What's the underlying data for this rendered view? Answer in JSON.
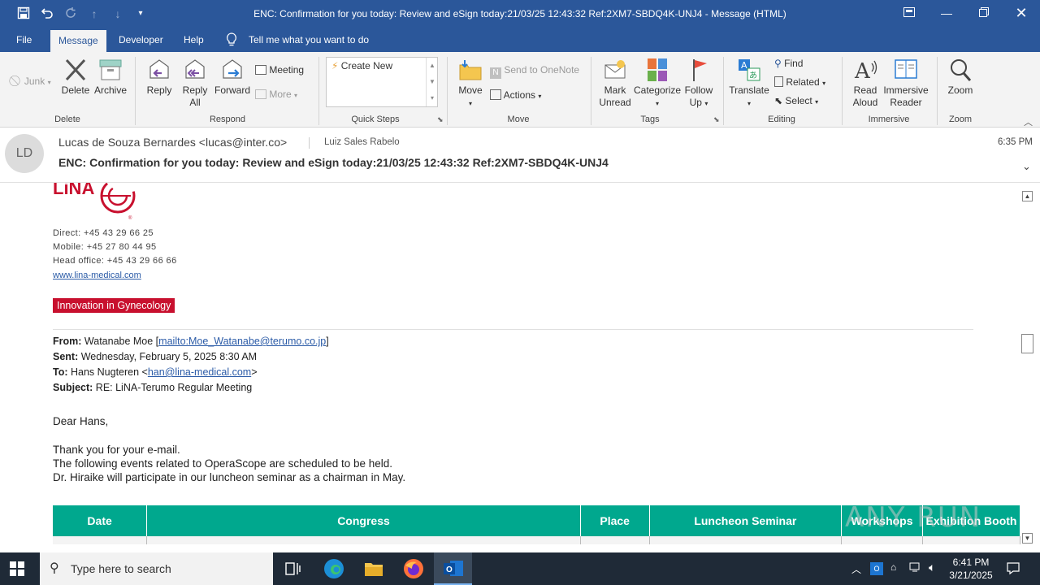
{
  "window": {
    "title": "ENC: Confirmation for you today: Review and eSign today:21/03/25 12:43:32 Ref:2XM7-SBDQ4K-UNJ4  -  Message (HTML)"
  },
  "tabs": [
    {
      "label": "File"
    },
    {
      "label": "Message"
    },
    {
      "label": "Developer"
    },
    {
      "label": "Help"
    }
  ],
  "tell_me": "Tell me what you want to do",
  "ribbon": {
    "junk": "Junk",
    "delete": "Delete",
    "archive": "Archive",
    "group_delete": "Delete",
    "reply": "Reply",
    "reply_all_1": "Reply",
    "reply_all_2": "All",
    "forward": "Forward",
    "meeting": "Meeting",
    "more": "More",
    "group_respond": "Respond",
    "quick_create_new": "Create New",
    "group_quick_steps": "Quick Steps",
    "move": "Move",
    "send_onenote": "Send to OneNote",
    "actions": "Actions",
    "group_move": "Move",
    "mark_unread_1": "Mark",
    "mark_unread_2": "Unread",
    "categorize": "Categorize",
    "follow_up_1": "Follow",
    "follow_up_2": "Up",
    "group_tags": "Tags",
    "translate": "Translate",
    "find": "Find",
    "related": "Related",
    "select": "Select",
    "group_editing": "Editing",
    "read_aloud_1": "Read",
    "read_aloud_2": "Aloud",
    "immersive_1": "Immersive",
    "immersive_2": "Reader",
    "group_immersive": "Immersive",
    "zoom": "Zoom",
    "group_zoom": "Zoom"
  },
  "header": {
    "avatar_initials": "LD",
    "sender": "Lucas de Souza Bernardes <lucas@inter.co>",
    "recipient": "Luiz Sales Rabelo",
    "time": "6:35 PM",
    "subject": "ENC: Confirmation for you today: Review and eSign today:21/03/25 12:43:32 Ref:2XM7-SBDQ4K-UNJ4"
  },
  "signature": {
    "logo_text": "LiNA",
    "direct": "Direct: +45 43 29 66 25",
    "mobile": "Mobile: +45 27 80 44 95",
    "head_office": "Head office: +45 43 29 66 66",
    "website": "www.lina-medical.com",
    "banner": "Innovation in Gynecology",
    "brand_red": "#c8102e"
  },
  "forwarded": {
    "from_label": "From:",
    "from_name": "Watanabe Moe [",
    "from_link": "mailto:Moe_Watanabe@terumo.co.jp",
    "from_end": "]",
    "sent_label": "Sent:",
    "sent_value": "Wednesday, February 5, 2025 8:30 AM",
    "to_label": "To:",
    "to_name": "Hans Nugteren <",
    "to_link": "han@lina-medical.com",
    "to_end": ">",
    "subject_label": "Subject:",
    "subject_value": "RE: LiNA-Terumo Regular Meeting"
  },
  "message": {
    "greeting": "Dear Hans,",
    "line1": "Thank you for your e-mail.",
    "line2": "The following events related to OperaScope are scheduled to be held.",
    "line3": "Dr. Hiraike will participate in our luncheon seminar as a chairman in May."
  },
  "table": {
    "headers": [
      "Date",
      "Congress",
      "Place",
      "Luncheon Seminar",
      "Workshops",
      "Exhibition Booth"
    ],
    "header_color": "#00a88e"
  },
  "watermark": "ANY RUN",
  "taskbar": {
    "search_placeholder": "Type here to search",
    "time": "6:41 PM",
    "date": "3/21/2025"
  },
  "colors": {
    "office_blue": "#2b579a",
    "ribbon_bg": "#f3f3f3",
    "taskbar": "#1f2a37"
  }
}
